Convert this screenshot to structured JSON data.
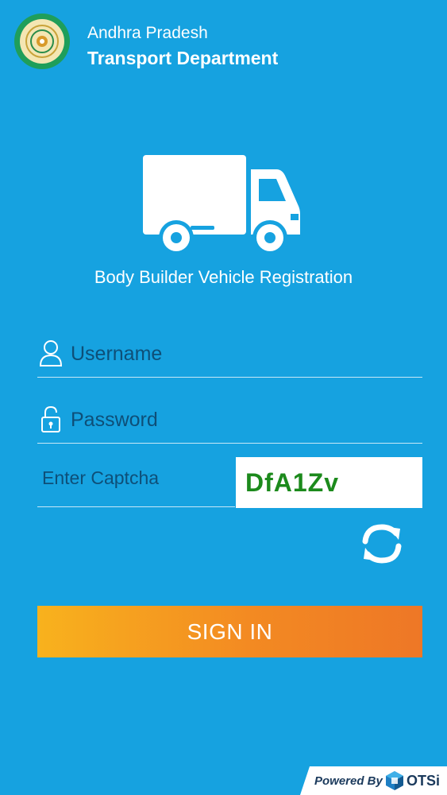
{
  "header": {
    "state": "Andhra Pradesh",
    "department": "Transport Department",
    "emblem_icon": "state-emblem-icon"
  },
  "app": {
    "title": "Body Builder Vehicle Registration",
    "hero_icon": "truck-icon"
  },
  "form": {
    "username": {
      "placeholder": "Username",
      "icon": "user-icon"
    },
    "password": {
      "placeholder": "Password",
      "icon": "lock-icon"
    },
    "captcha": {
      "placeholder": "Enter Captcha",
      "code": "DfA1Zv",
      "refresh_icon": "refresh-icon"
    },
    "sign_in_label": "SIGN IN"
  },
  "footer": {
    "powered_by": "Powered By",
    "brand": "OTSi"
  },
  "colors": {
    "background": "#16a2e0",
    "button_start": "#f8b21d",
    "button_end": "#ee7726",
    "captcha_text": "#1c8a1c",
    "placeholder": "#0e4f78"
  }
}
